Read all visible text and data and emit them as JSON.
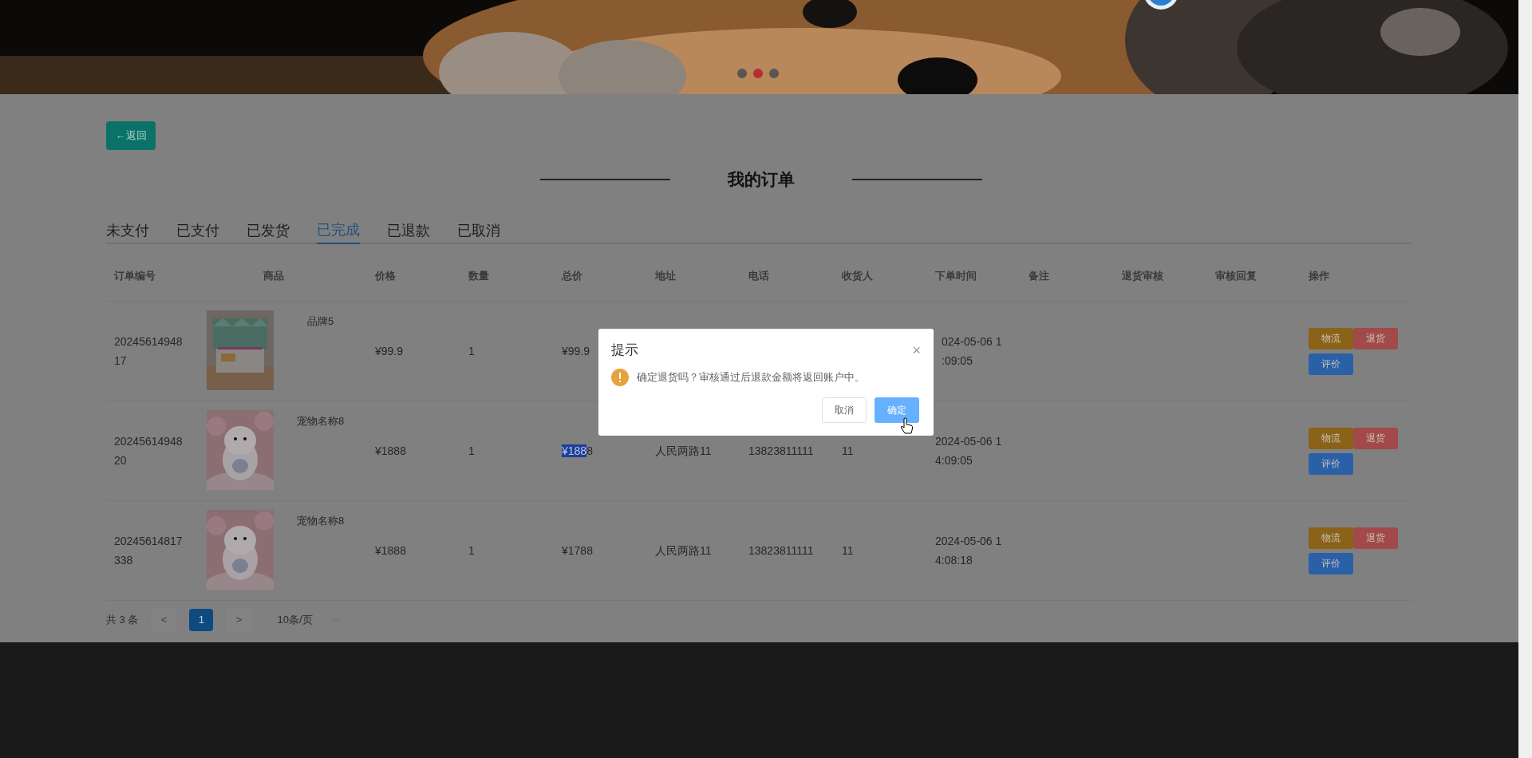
{
  "banner": {
    "kind": "picture",
    "dots": [
      {
        "selected": false
      },
      {
        "selected": true
      },
      {
        "selected": false
      }
    ]
  },
  "back_button": "←返回",
  "title": "我的订单",
  "tabs": [
    {
      "label": "未支付",
      "selected": false
    },
    {
      "label": "已支付",
      "selected": false
    },
    {
      "label": "已发货",
      "selected": false
    },
    {
      "label": "已完成",
      "selected": true
    },
    {
      "label": "已退款",
      "selected": false
    },
    {
      "label": "已取消",
      "selected": false
    }
  ],
  "table": {
    "columns": [
      "订单编号",
      "商品",
      "价格",
      "数量",
      "总价",
      "地址",
      "电话",
      "收货人",
      "下单时间",
      "备注",
      "退货审核",
      "审核回复",
      "操作"
    ],
    "rows": [
      {
        "order_no": [
          "20245614948",
          "17"
        ],
        "product": {
          "name": "品牌5"
        },
        "price": "¥99.9",
        "qty": "1",
        "total": [
          {
            "text": "¥99.9",
            "highlighted": false
          }
        ],
        "order_time": [
          "024-05-06 1",
          ":09:05"
        ],
        "actions": [
          {
            "label": "物流",
            "kind": "logistics"
          },
          {
            "label": "退货",
            "kind": "refund"
          },
          {
            "label": "评价",
            "kind": "review"
          }
        ]
      },
      {
        "order_no": [
          "20245614948",
          "20"
        ],
        "product": {
          "name": "宠物名称8"
        },
        "price": "¥1888",
        "qty": "1",
        "total": [
          {
            "text": "¥188",
            "highlighted": true
          },
          {
            "text": "8",
            "highlighted": false
          }
        ],
        "address": "人民两路11",
        "phone": "13823811111",
        "receiver": "11",
        "order_time": [
          "2024-05-06 1",
          "4:09:05"
        ],
        "actions": [
          {
            "label": "物流",
            "kind": "logistics"
          },
          {
            "label": "退货",
            "kind": "refund"
          },
          {
            "label": "评价",
            "kind": "review"
          }
        ]
      },
      {
        "order_no": [
          "20245614817",
          "338"
        ],
        "product": {
          "name": "宠物名称8"
        },
        "price": "¥1888",
        "qty": "1",
        "total": [
          {
            "text": "¥1788",
            "highlighted": false
          }
        ],
        "address": "人民两路11",
        "phone": "13823811111",
        "receiver": "11",
        "order_time": [
          "2024-05-06 1",
          "4:08:18"
        ],
        "actions": [
          {
            "label": "物流",
            "kind": "logistics"
          },
          {
            "label": "退货",
            "kind": "refund"
          },
          {
            "label": "评价",
            "kind": "review"
          }
        ]
      }
    ]
  },
  "pagination": {
    "total": "共 3 条",
    "prev": "<",
    "pages": [
      {
        "label": "1",
        "selected": true
      }
    ],
    "next": ">",
    "page_size": "10条/页"
  },
  "dialog": {
    "title": "提示",
    "close": "×",
    "message": "确定退货吗？审核通过后退款金额将返回账户中。",
    "buttons": [
      {
        "label": "取消",
        "kind": "cancel"
      },
      {
        "label": "确定",
        "kind": "confirm"
      }
    ]
  }
}
